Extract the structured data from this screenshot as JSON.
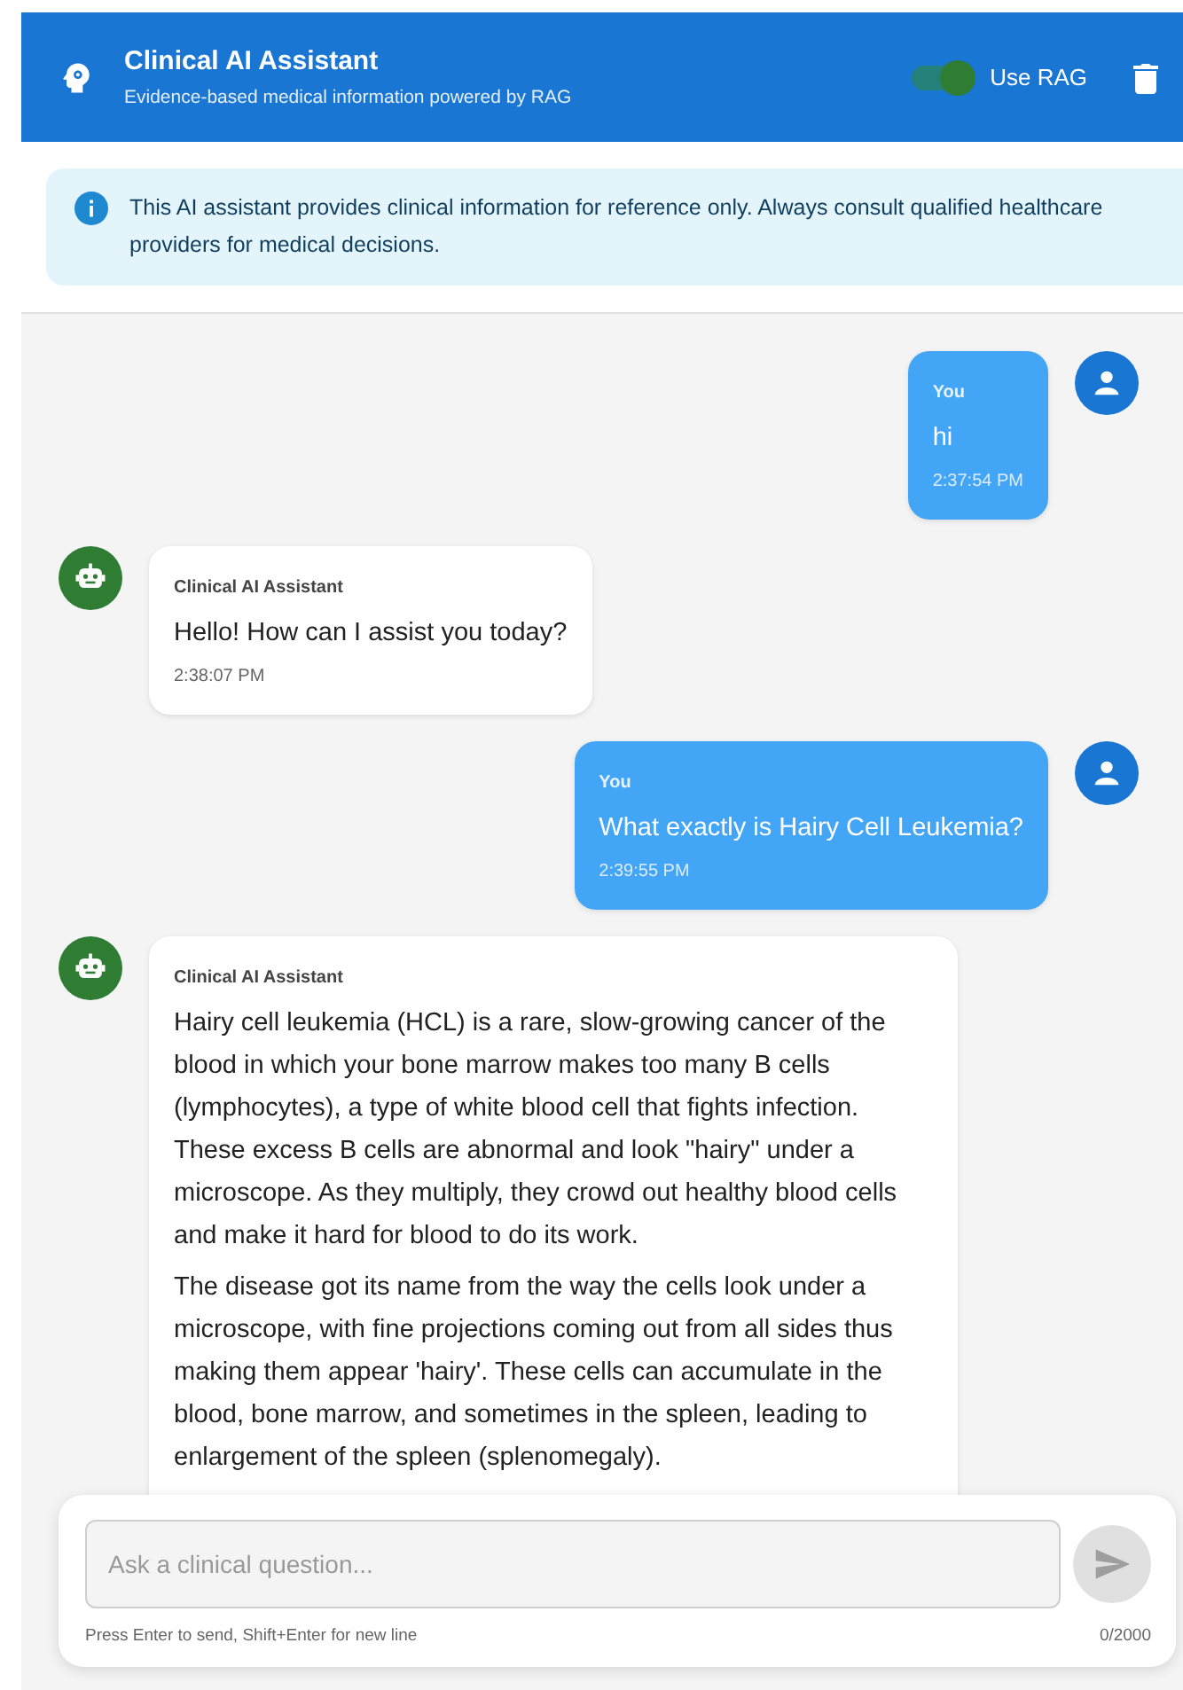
{
  "header": {
    "title": "Clinical AI Assistant",
    "subtitle": "Evidence-based medical information powered by RAG",
    "rag_toggle": {
      "label": "Use RAG",
      "on": true
    }
  },
  "notice": {
    "text": "This AI assistant provides clinical information for reference only. Always consult qualified healthcare providers for medical decisions."
  },
  "messages": [
    {
      "kind": "user",
      "sender": "You",
      "paragraphs": [
        "hi"
      ],
      "time": "2:37:54 PM"
    },
    {
      "kind": "assistant",
      "sender": "Clinical AI Assistant",
      "paragraphs": [
        "Hello! How can I assist you today?"
      ],
      "time": "2:38:07 PM"
    },
    {
      "kind": "user",
      "sender": "You",
      "paragraphs": [
        "What exactly is Hairy Cell Leukemia?"
      ],
      "time": "2:39:55 PM"
    },
    {
      "kind": "assistant",
      "sender": "Clinical AI Assistant",
      "paragraphs": [
        "Hairy cell leukemia (HCL) is a rare, slow-growing cancer of the blood in which your bone marrow makes too many B cells (lymphocytes), a type of white blood cell that fights infection. These excess B cells are abnormal and look \"hairy\" under a microscope. As they multiply, they crowd out healthy blood cells and make it hard for blood to do its work.",
        "The disease got its name from the way the cells look under a microscope, with fine projections coming out from all sides thus making them appear 'hairy'. These cells can accumulate in the blood, bone marrow, and sometimes in the spleen, leading to enlargement of the spleen (splenomegaly)."
      ]
    }
  ],
  "composer": {
    "placeholder": "Ask a clinical question...",
    "hint": "Press Enter to send, Shift+Enter for new line",
    "counter": "0/2000"
  }
}
